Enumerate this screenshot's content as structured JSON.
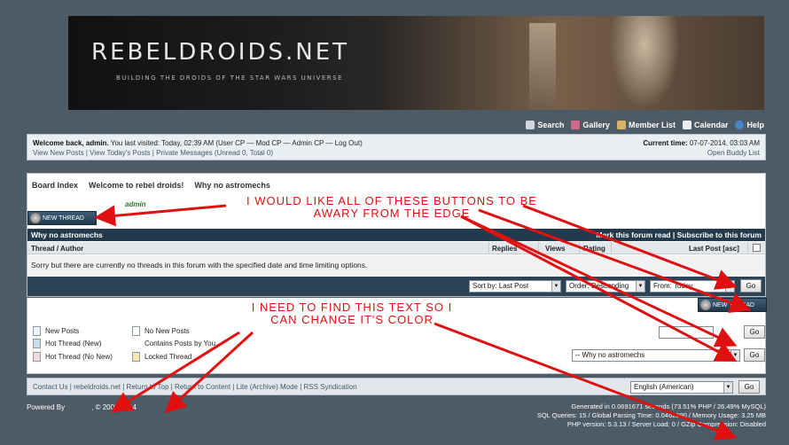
{
  "banner": {
    "title": "REBELDROIDS.NET",
    "subtitle": "BUILDING THE DROIDS OF THE STAR WARS UNIVERSE"
  },
  "topnav": [
    "Search",
    "Gallery",
    "Member List",
    "Calendar",
    "Help"
  ],
  "welcome": {
    "greeting_bold": "Welcome back, admin.",
    "greeting_rest": "You last visited: Today, 02:39 AM (User CP — Mod CP — Admin CP — Log Out)",
    "links": "View New Posts | View Today's Posts | Private Messages (Unread 0, Total 0)",
    "time_label": "Current time:",
    "time_value": "07-07-2014, 03:03 AM",
    "buddy": "Open Buddy List"
  },
  "breadcrumb": [
    "Board Index",
    "Welcome to rebel droids!",
    "Why no astromechs"
  ],
  "moderator": "admin",
  "new_thread_label": "NEW THREAD",
  "forum": {
    "title": "Why no astromechs",
    "actions": "Mark this forum read | Subscribe to this forum",
    "columns": {
      "thread": "Thread / Author",
      "replies": "Replies",
      "views": "Views",
      "rating": "Rating",
      "lastpost": "Last Post [asc]"
    },
    "empty_msg": "Sorry but there are currently no threads in this forum with the specified date and time limiting options."
  },
  "sort": {
    "sortby": "Sort by: Last Post",
    "order": "Order: Descending",
    "from": "From: Today",
    "go": "Go"
  },
  "legend": [
    "New Posts",
    "No New Posts",
    "Hot Thread (New)",
    "Contains Posts by You",
    "Hot Thread (No New)",
    "Locked Thread"
  ],
  "jump": {
    "forum_select": "-- Why no astromechs",
    "go": "Go"
  },
  "footer": {
    "links": "Contact Us | rebeldroids.net | Return to Top | Return to Content | Lite (Archive) Mode | RSS Syndication",
    "language": "English (American)",
    "go": "Go",
    "powered": "Powered By",
    "copyright": ", © 2002-2014",
    "stats": [
      "Generated in 0.0691671 seconds (73.51% PHP / 26.49% MySQL)",
      "SQL Queries: 15 / Global Parsing Time: 0.0462890 / Memory Usage: 3.25 MB",
      "PHP version: 5.3.13 / Server Load: 0 / GZip Compression: Disabled"
    ]
  },
  "annotations": {
    "a1_line1": "I WOULD LIKE ALL OF THESE BUTTONS TO BE",
    "a1_line2": "AWARY FROM THE EDGE",
    "a2_line1": "I NEED TO FIND THIS TEXT SO I",
    "a2_line2": "CAN CHANGE IT'S COLOR"
  }
}
